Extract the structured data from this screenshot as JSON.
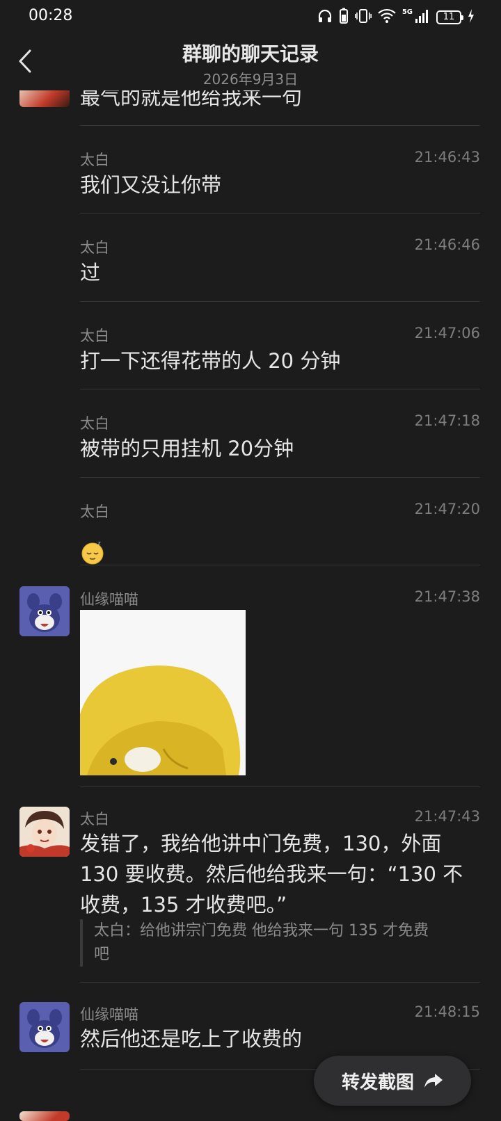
{
  "status_bar": {
    "time": "00:28",
    "network": "5G",
    "battery": "11"
  },
  "header": {
    "title": "群聊的聊天记录",
    "date": "2026年9月3日"
  },
  "messages": [
    {
      "sender": "",
      "time": "",
      "text": "最气的就是他给我来一句"
    },
    {
      "sender": "太白",
      "time": "21:46:43",
      "text": "我们又没让你带"
    },
    {
      "sender": "太白",
      "time": "21:46:46",
      "text": "过"
    },
    {
      "sender": "太白",
      "time": "21:47:06",
      "text": "打一下还得花带的人 20 分钟"
    },
    {
      "sender": "太白",
      "time": "21:47:18",
      "text": "被带的只用挂机 20分钟"
    },
    {
      "sender": "太白",
      "time": "21:47:20",
      "emoji": "😴"
    },
    {
      "sender": "仙缘喵喵",
      "time": "21:47:38",
      "image": "yellow-blob-sticker"
    },
    {
      "sender": "太白",
      "time": "21:47:43",
      "text_lines": [
        "发错了，我给他讲中门免费，130，外面",
        "130 要收费。然后他给我来一句：“130 不",
        "收费，135 才收费吧。”"
      ],
      "quote_lines": [
        "太白：给他讲宗门免费 他给我来一句 135 才免费",
        "吧"
      ]
    },
    {
      "sender": "仙缘喵喵",
      "time": "21:48:15",
      "text": "然后他还是吃上了收费的"
    }
  ],
  "forward_button": {
    "label": "转发截图"
  },
  "colors": {
    "background": "#1c1c1d",
    "text": "#e6e6e6",
    "muted": "#8b8b8b",
    "divider": "#363637"
  }
}
